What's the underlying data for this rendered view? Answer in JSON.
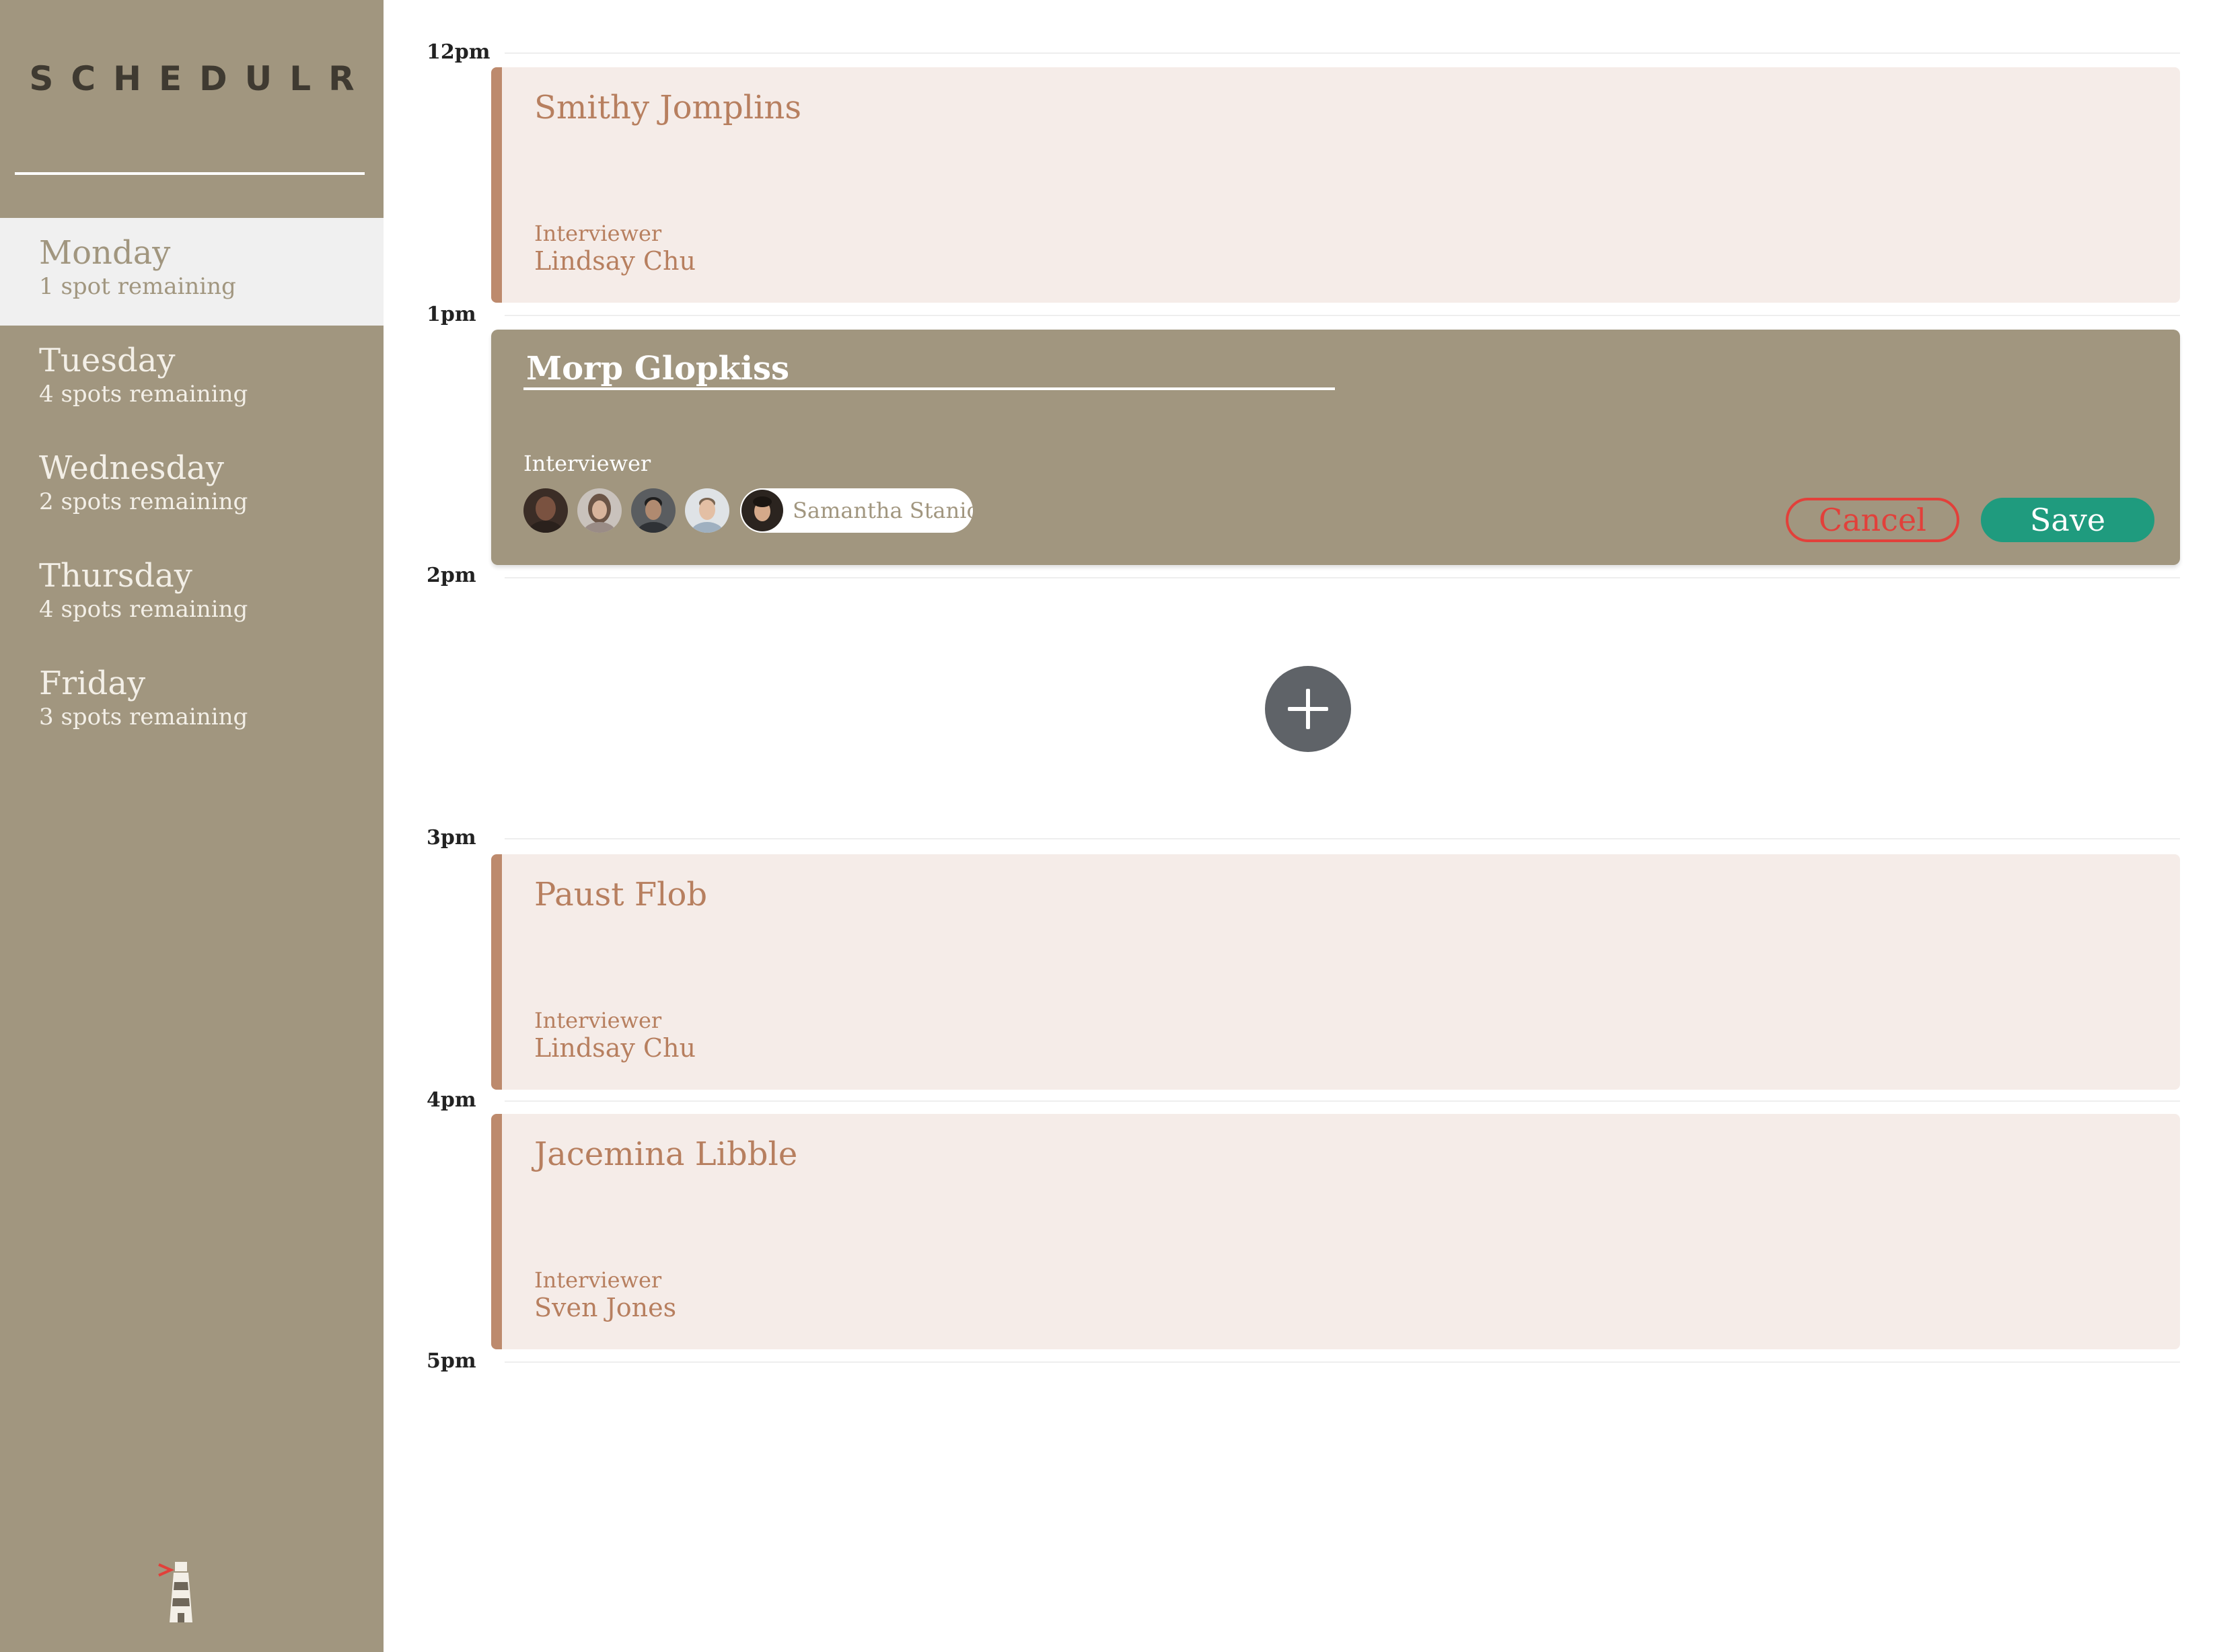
{
  "app": {
    "logo": "SCHEDULR"
  },
  "sidebar": {
    "days": [
      {
        "name": "Monday",
        "spots": "1 spot remaining",
        "selected": true
      },
      {
        "name": "Tuesday",
        "spots": "4 spots remaining"
      },
      {
        "name": "Wednesday",
        "spots": "2 spots remaining"
      },
      {
        "name": "Thursday",
        "spots": "4 spots remaining"
      },
      {
        "name": "Friday",
        "spots": "3 spots remaining"
      }
    ]
  },
  "schedule": {
    "times": [
      "12pm",
      "1pm",
      "2pm",
      "3pm",
      "4pm",
      "5pm"
    ],
    "interviewer_label": "Interviewer",
    "appointments": [
      {
        "time": "12pm",
        "student": "Smithy Jomplins",
        "interviewer": "Lindsay Chu"
      },
      {
        "time": "3pm",
        "student": "Paust Flob",
        "interviewer": "Lindsay Chu"
      },
      {
        "time": "4pm",
        "student": "Jacemina Libble",
        "interviewer": "Sven Jones"
      }
    ],
    "edit_form": {
      "time": "1pm",
      "student_value": "Morp Glopkiss",
      "selected_interviewer": "Samantha Stanic",
      "cancel_label": "Cancel",
      "save_label": "Save"
    }
  },
  "colors": {
    "sidebar_bg": "#a1967f",
    "appointment_bg": "#f5ece8",
    "accent": "#bd8a6d",
    "cancel": "#e2403a",
    "save": "#1f9b7e",
    "add_button": "#5f6368"
  },
  "icons": [
    "add-icon",
    "lighthouse-icon"
  ]
}
